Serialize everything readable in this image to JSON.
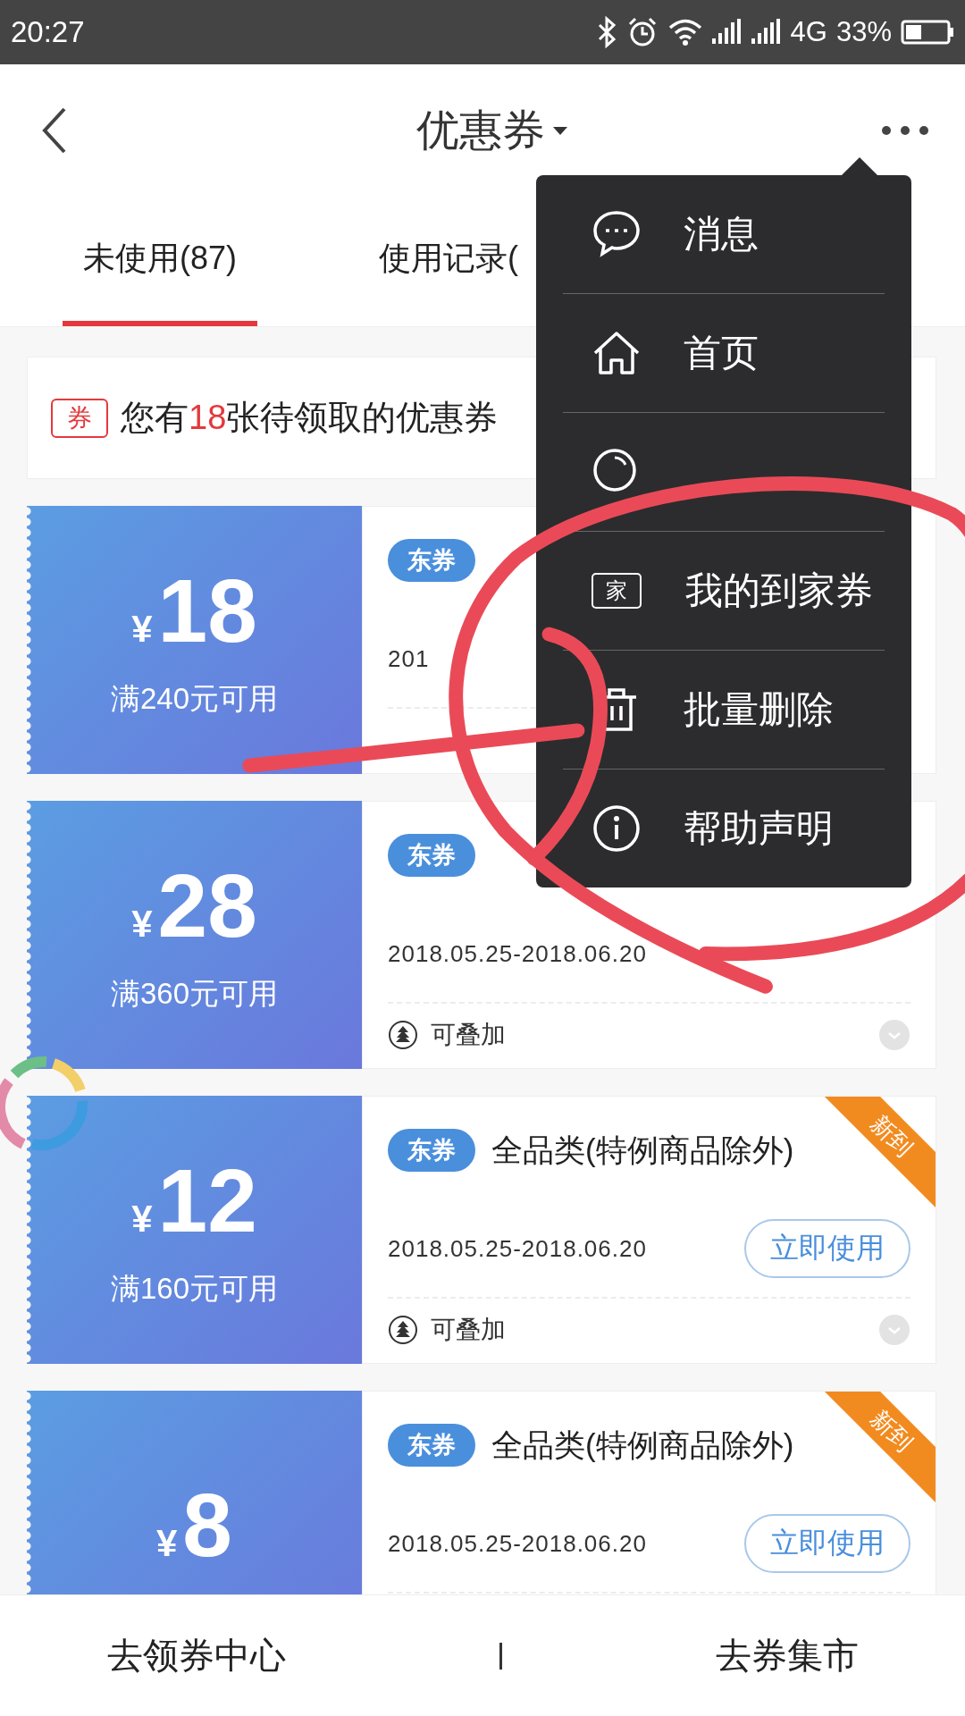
{
  "status_bar": {
    "time": "20:27",
    "network": "4G",
    "battery": "33%"
  },
  "header": {
    "title": "优惠券"
  },
  "tabs": [
    {
      "label": "未使用(87)",
      "selected": true
    },
    {
      "label": "使用记录(",
      "selected": false
    }
  ],
  "banner": {
    "icon_text": "券",
    "text": "您有**18**张待领取的优惠券"
  },
  "coupons": [
    {
      "currency": "¥",
      "amount": "18",
      "condition": "满240元可用",
      "tag": "东券",
      "period": "201"
    },
    {
      "currency": "¥",
      "amount": "28",
      "condition": "满360元可用",
      "tag": "东券",
      "period": "2018.05.25-2018.06.20",
      "stackable": "可叠加"
    },
    {
      "currency": "¥",
      "amount": "12",
      "condition": "满160元可用",
      "tag": "东券",
      "scope": "全品类(特例商品除外)",
      "period": "2018.05.25-2018.06.20",
      "button": "立即使用",
      "stackable": "可叠加",
      "badge": "新到"
    },
    {
      "currency": "¥",
      "amount": "8",
      "tag": "东券",
      "scope": "全品类(特例商品除外)",
      "period": "2018.05.25-2018.06.20",
      "button": "立即使用",
      "badge": "新到"
    }
  ],
  "menu": {
    "items": [
      {
        "kind": "message",
        "label": "消息"
      },
      {
        "kind": "home",
        "label": "首页"
      },
      {
        "kind": "search"
      },
      {
        "kind": "ticket",
        "label": "我的到家券",
        "icon_text": "家"
      },
      {
        "kind": "delete",
        "label": "批量删除"
      },
      {
        "kind": "info",
        "label": "帮助声明"
      }
    ]
  },
  "bottom_bar": {
    "links": [
      "去领券中心",
      "去券集市"
    ]
  }
}
